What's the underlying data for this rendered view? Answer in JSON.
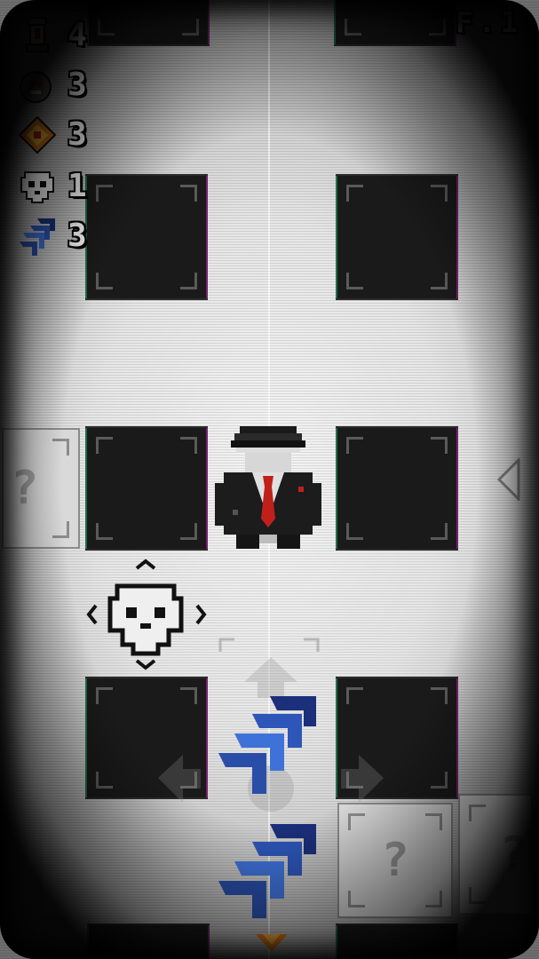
{
  "hud": {
    "floor_label": "F.1",
    "stats": [
      {
        "icon": "lantern-icon",
        "value": "4"
      },
      {
        "icon": "skull-bomb-icon",
        "value": "3"
      },
      {
        "icon": "diamond-gem-icon",
        "value": "3"
      },
      {
        "icon": "skull-icon",
        "value": "1"
      },
      {
        "icon": "blue-arrows-icon",
        "value": "3"
      }
    ]
  },
  "tiles": {
    "unknown_symbol": "?"
  },
  "colors": {
    "wall": "#e6e6e6",
    "tile_dark": "#1a1a1a",
    "tie_red": "#c0201a",
    "arrow_blue": "#2d56b8",
    "hud_text": "#ffffff"
  }
}
